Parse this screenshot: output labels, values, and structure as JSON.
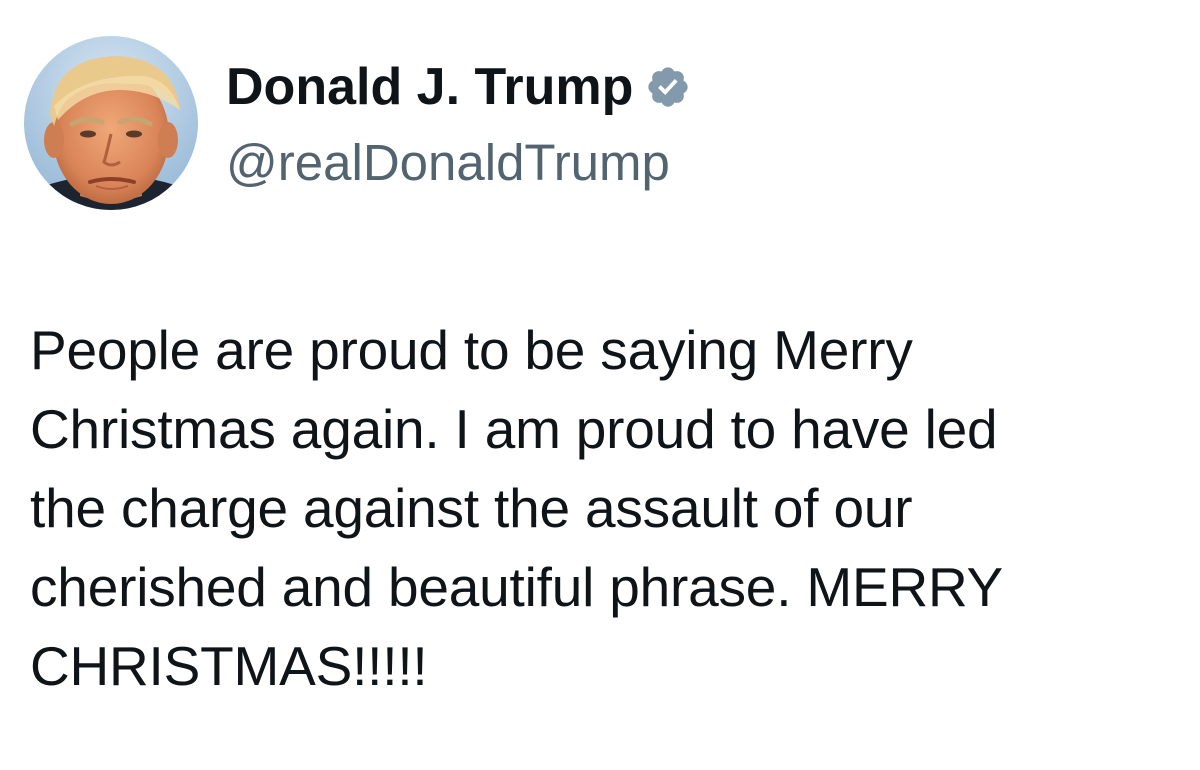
{
  "author": {
    "display_name": "Donald J. Trump",
    "handle": "@realDonaldTrump",
    "verified": true,
    "verified_icon": "verified-badge-icon",
    "verified_color": "#829aab"
  },
  "tweet": {
    "text": "People are proud to be saying Merry\nChristmas again. I am proud to have led\nthe charge against the assault of our\ncherished and beautiful phrase. MERRY\nCHRISTMAS!!!!!"
  },
  "colors": {
    "text_primary": "#0f1419",
    "text_secondary": "#536471",
    "background": "#ffffff"
  }
}
